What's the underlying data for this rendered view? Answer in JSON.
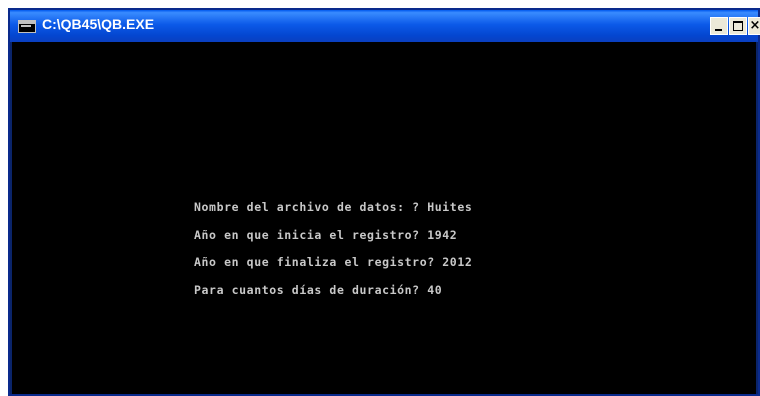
{
  "window": {
    "title": "C:\\QB45\\QB.EXE",
    "controls": {
      "minimize_icon": "minimize-icon",
      "maximize_icon": "maximize-icon",
      "close_label": "×"
    }
  },
  "console": {
    "lines": [
      "Nombre del archivo de datos: ? Huites",
      "Año en que inicia el registro? 1942",
      "Año en que finaliza el registro? 2012",
      "Para cuantos días de duración? 40"
    ],
    "foreground_color": "#c8c8c8",
    "background_color": "#000000"
  }
}
